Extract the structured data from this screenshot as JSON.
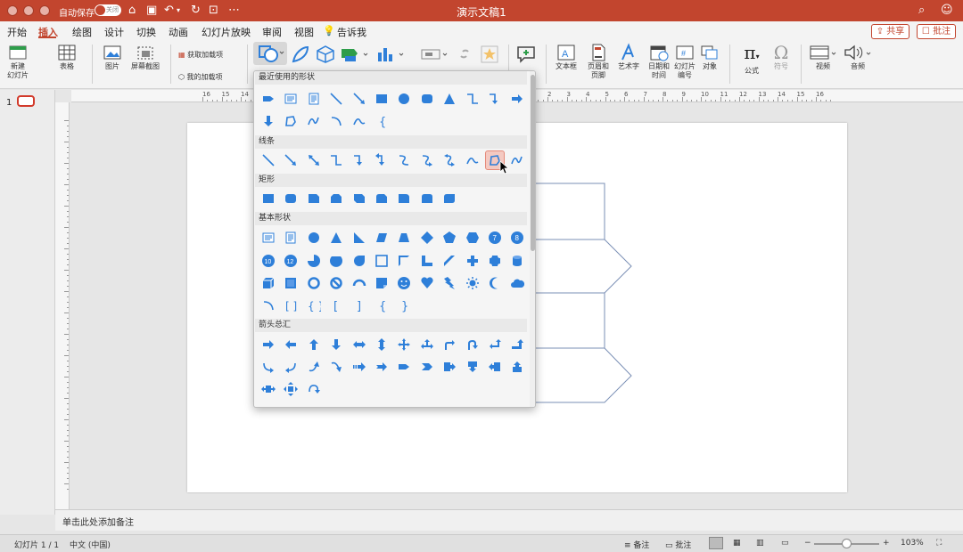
{
  "titlebar": {
    "autosave_label": "自动保存",
    "autosave_state": "关闭",
    "doc_title": "演示文稿1"
  },
  "menu": {
    "tabs": [
      "开始",
      "插入",
      "绘图",
      "设计",
      "切换",
      "动画",
      "幻灯片放映",
      "审阅",
      "视图",
      "告诉我"
    ],
    "active": "插入",
    "share": "共享",
    "comments": "批注"
  },
  "ribbon": {
    "new_slide": "新建\n幻灯片",
    "table": "表格",
    "picture": "图片",
    "screenshot": "屏幕截图",
    "get_addins": "获取加载项",
    "my_addins": "我的加载项",
    "textbox": "文本框",
    "header_footer": "页眉和\n页脚",
    "wordart": "艺术字",
    "datetime": "日期和\n时间",
    "slide_number": "幻灯片\n编号",
    "object": "对象",
    "equation": "公式",
    "symbol": "符号",
    "video": "视频",
    "audio": "音频"
  },
  "ruler_top": [
    "16",
    "15",
    "14",
    "13",
    "12",
    "11",
    "10",
    "9",
    "8",
    "7",
    "6",
    "5",
    "4",
    "3",
    "2",
    "1",
    "0",
    "1",
    "2",
    "3",
    "4",
    "5",
    "6",
    "7",
    "8",
    "9",
    "10",
    "11",
    "12",
    "13",
    "14",
    "15",
    "16"
  ],
  "slide_panel": {
    "number": "1"
  },
  "dropdown": {
    "sections": [
      {
        "title": "最近使用的形状",
        "rows": [
          [
            "pentagon-arrow",
            "text-box",
            "vertical-text-box",
            "line",
            "arrow-line",
            "rectangle",
            "oval",
            "rounded-rectangle",
            "triangle",
            "elbow-connector",
            "elbow-arrow-connector",
            "right-arrow"
          ],
          [
            "down-arrow",
            "freeform",
            "scribble",
            "arc",
            "curve",
            "left-brace"
          ]
        ]
      },
      {
        "title": "线条",
        "rows": [
          [
            "line",
            "arrow-line",
            "double-arrow-line",
            "elbow-connector",
            "elbow-arrow-connector",
            "elbow-double-arrow",
            "curved-connector",
            "curved-arrow-connector",
            "curved-double-arrow",
            "curve",
            "freeform",
            "scribble"
          ]
        ]
      },
      {
        "title": "矩形",
        "rows": [
          [
            "rectangle",
            "rounded-rectangle",
            "snip-single-corner",
            "snip-same-side",
            "snip-diagonal",
            "snip-round-single",
            "round-single-corner",
            "round-same-side",
            "round-diagonal"
          ]
        ]
      },
      {
        "title": "基本形状",
        "rows": [
          [
            "text-box",
            "vertical-text-box",
            "oval",
            "triangle",
            "right-triangle",
            "parallelogram",
            "trapezoid",
            "diamond",
            "pentagon",
            "hexagon",
            "heptagon",
            "octagon"
          ],
          [
            "decagon",
            "dodecagon",
            "pie",
            "chord",
            "teardrop",
            "frame",
            "half-frame",
            "l-shape",
            "diagonal-stripe",
            "cross",
            "plaque",
            "can"
          ],
          [
            "cube",
            "bevel",
            "donut",
            "no-symbol",
            "block-arc",
            "folded-corner",
            "smiley",
            "heart",
            "lightning",
            "sun",
            "moon",
            "cloud"
          ],
          [
            "arc",
            "double-bracket",
            "double-brace",
            "left-bracket",
            "right-bracket",
            "left-brace",
            "right-brace"
          ]
        ]
      },
      {
        "title": "箭头总汇",
        "rows": [
          [
            "right-arrow",
            "left-arrow",
            "up-arrow",
            "down-arrow",
            "left-right-arrow",
            "up-down-arrow",
            "quad-arrow",
            "left-right-up-arrow",
            "bent-arrow",
            "u-turn-arrow",
            "left-up-arrow",
            "bent-up-arrow"
          ],
          [
            "curved-right-arrow",
            "curved-left-arrow",
            "curved-up-arrow",
            "curved-down-arrow",
            "striped-right-arrow",
            "notched-right-arrow",
            "pentagon-arrow",
            "chevron",
            "right-arrow-callout",
            "down-arrow-callout",
            "left-arrow-callout",
            "up-arrow-callout"
          ],
          [
            "left-right-arrow-callout",
            "quad-arrow-callout",
            "circular-arrow"
          ]
        ]
      }
    ],
    "selected": "freeform"
  },
  "notes": {
    "placeholder": "单击此处添加备注"
  },
  "status": {
    "slide_count": "幻灯片 1 / 1",
    "language": "中文 (中国)",
    "notes": "备注",
    "comments": "批注",
    "zoom": "103%"
  },
  "colors": {
    "accent": "#c2452e",
    "shape_blue": "#2e7fd9"
  }
}
